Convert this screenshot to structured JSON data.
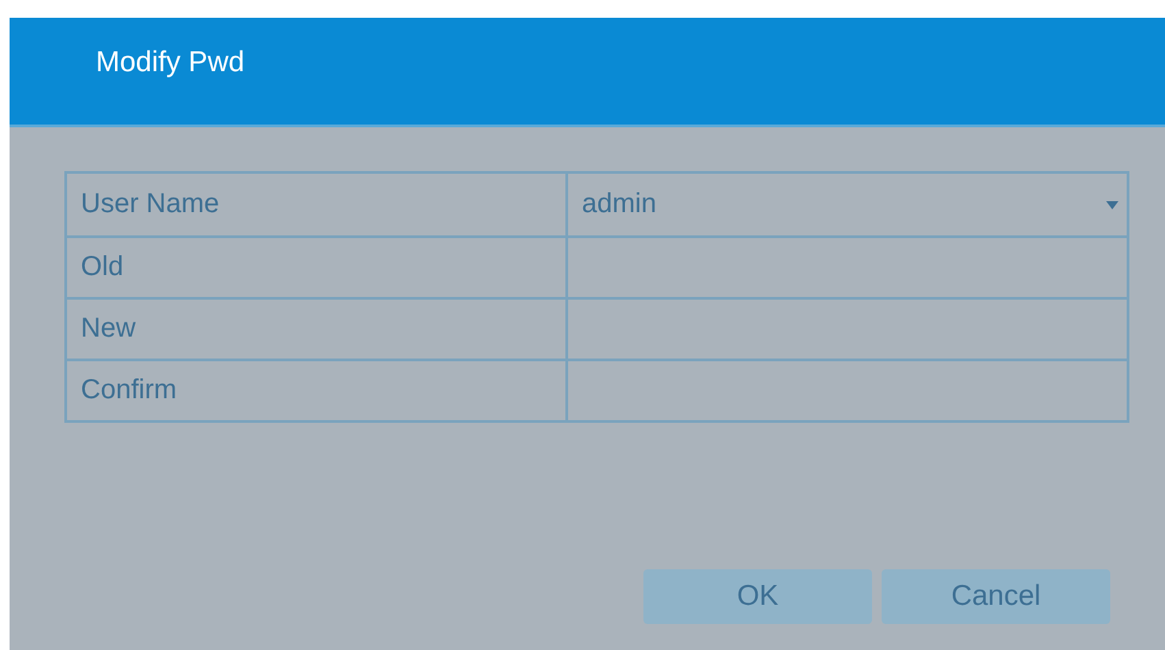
{
  "window": {
    "title": "Modify Pwd"
  },
  "fields": [
    {
      "label": "User Name",
      "kind": "select",
      "value": "admin"
    },
    {
      "label": "Old",
      "kind": "password"
    },
    {
      "label": "New",
      "kind": "password"
    },
    {
      "label": "Confirm",
      "kind": "password"
    }
  ],
  "buttons": [
    "OK",
    "Cancel"
  ]
}
